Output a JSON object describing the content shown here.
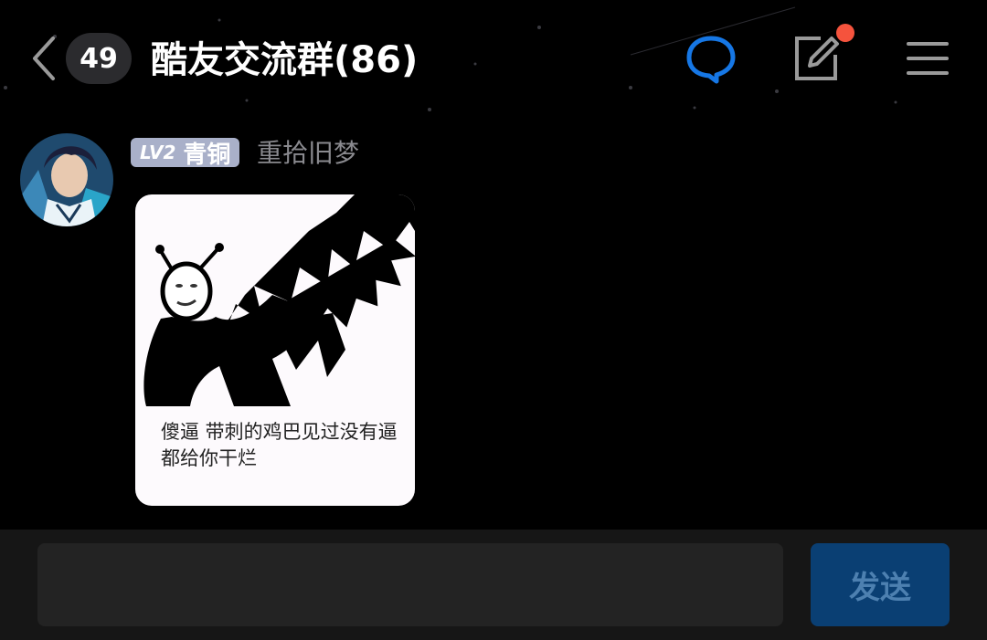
{
  "header": {
    "unread_count": "49",
    "title": "酷友交流群(86)",
    "icons": [
      "back-chevron-icon",
      "chat-bubble-icon",
      "edit-icon",
      "menu-icon"
    ],
    "accent_color": "#1677e5",
    "notification_dot_color": "#f5533d"
  },
  "message": {
    "badge_level": "LV2",
    "badge_rank": "青铜",
    "badge_color": "#a9b0c9",
    "nickname": "重拾旧梦",
    "sticker_caption": "傻逼 带刺的鸡巴见过没有逼都给你干烂"
  },
  "composer": {
    "input_value": "",
    "input_placeholder": "",
    "send_label": "发送"
  }
}
